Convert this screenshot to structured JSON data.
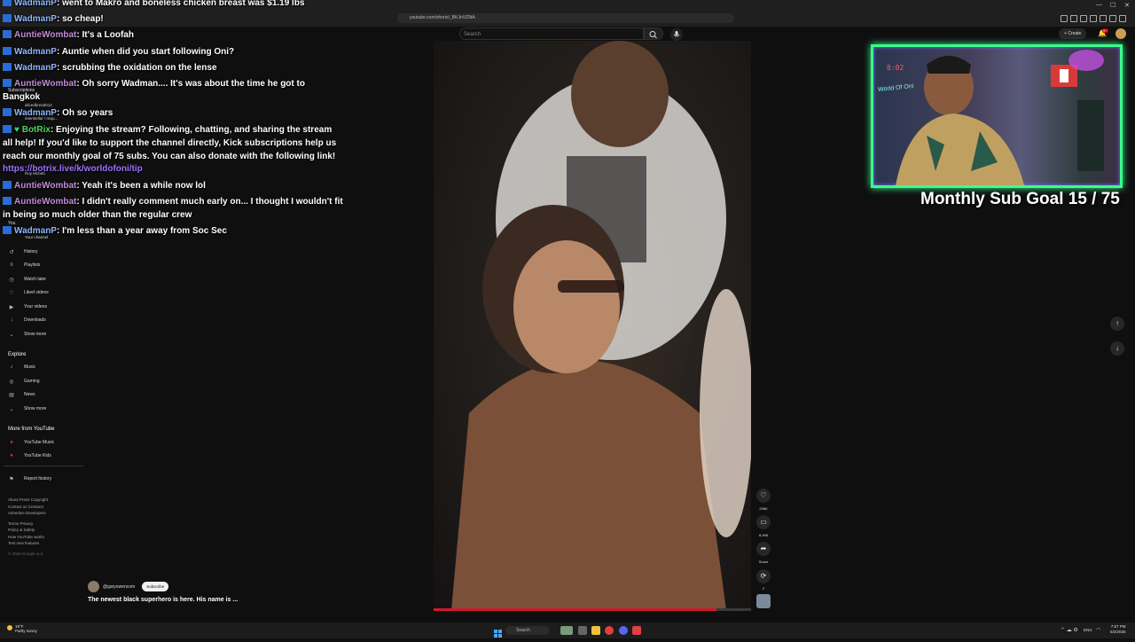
{
  "browser": {
    "url": "youtube.com/shorts/_BKJnVZ9tA",
    "window_controls": [
      "—",
      "☐",
      "✕"
    ]
  },
  "yt_header": {
    "search_placeholder": "Search",
    "create_label": "Create",
    "notification_count": "9+"
  },
  "sidebar": {
    "partial_labels": [
      "Subscriptions",
      "alicedbread012",
      "interstellar / requ...",
      "Roy Mcbeb",
      "You",
      "Your channel"
    ],
    "you_items": [
      {
        "icon": "history-icon",
        "glyph": "↺",
        "label": "History"
      },
      {
        "icon": "playlists-icon",
        "glyph": "≡",
        "label": "Playlists"
      },
      {
        "icon": "watch-later-icon",
        "glyph": "◷",
        "label": "Watch later"
      },
      {
        "icon": "liked-videos-icon",
        "glyph": "♡",
        "label": "Liked videos"
      },
      {
        "icon": "your-videos-icon",
        "glyph": "▶",
        "label": "Your videos"
      },
      {
        "icon": "downloads-icon",
        "glyph": "↓",
        "label": "Downloads"
      },
      {
        "icon": "chevron-down-icon",
        "glyph": "⌄",
        "label": "Show more"
      }
    ],
    "explore_heading": "Explore",
    "explore_items": [
      {
        "icon": "music-icon",
        "glyph": "♪",
        "label": "Music"
      },
      {
        "icon": "gaming-icon",
        "glyph": "◎",
        "label": "Gaming"
      },
      {
        "icon": "news-icon",
        "glyph": "▤",
        "label": "News"
      },
      {
        "icon": "chevron-down-icon",
        "glyph": "⌄",
        "label": "Show more"
      }
    ],
    "more_heading": "More from YouTube",
    "more_items": [
      {
        "icon": "youtube-music-icon",
        "glyph": "●",
        "label": "YouTube Music"
      },
      {
        "icon": "youtube-kids-icon",
        "glyph": "●",
        "label": "YouTube Kids"
      }
    ],
    "report_history": "Report history",
    "footer_lines": [
      "About  Press  Copyright",
      "Contact us  Creators",
      "Advertise  Developers",
      "",
      "Terms  Privacy",
      "Policy & Safety",
      "How YouTube works",
      "Test new features",
      "",
      "© 2026 Google LLC"
    ]
  },
  "chat": [
    {
      "user": "WadmanP",
      "text": ": went to Makro and boneless chicken breast was $1.19 lbs",
      "color": "u1"
    },
    {
      "user": "WadmanP",
      "text": ": so cheap!",
      "color": "u1"
    },
    {
      "user": "AuntieWombat",
      "text": ": It's a Loofah",
      "color": "u2"
    },
    {
      "user": "WadmanP",
      "text": ": Auntie when did you start following Oni?",
      "color": "u1"
    },
    {
      "user": "WadmanP",
      "text": ": scrubbing the oxidation on the lense",
      "color": "u1"
    },
    {
      "user": "AuntieWombat",
      "text": ": Oh sorry Wadman.... It's was about the time he got to",
      "color": "u2"
    },
    {
      "user": "",
      "text": "Bangkok",
      "color": "u1"
    },
    {
      "user": "WadmanP",
      "text": ": Oh so years",
      "color": "u1"
    },
    {
      "user": "BotRix",
      "text": ": Enjoying the stream? Following, chatting, and sharing the stream",
      "color": "u3"
    },
    {
      "user": "",
      "text": "all help! If you'd like to support the channel directly, Kick subscriptions help us",
      "color": "u1"
    },
    {
      "user": "",
      "text": "reach our monthly goal of 75 subs. You can also donate with the following link!",
      "color": "u1"
    },
    {
      "user": "",
      "text": "https://botrix.live/k/worldofoni/tip",
      "color": "link"
    },
    {
      "user": "AuntieWombat",
      "text": ": Yeah it's been a while now lol",
      "color": "u2"
    },
    {
      "user": "AuntieWombat",
      "text": ": I didn't really comment much early on... I thought I wouldn't fit",
      "color": "u2"
    },
    {
      "user": "",
      "text": "in being so much older than the regular crew",
      "color": "u1"
    },
    {
      "user": "WadmanP",
      "text": ": I'm less than a year away from Soc Sec",
      "color": "u1"
    }
  ],
  "short": {
    "channel": "@garyowencom",
    "subscribe_label": "Subscribe",
    "title": "The newest black superhero is here. His name is ...",
    "likes": "298K",
    "comments": "8,998",
    "share_label": "Share",
    "remix_count": "2",
    "progress": 0.89
  },
  "webcam": {
    "clock": "8:02",
    "neon_sign": "World Of Oni"
  },
  "overlay": {
    "sub_goal": "Monthly Sub Goal 15 / 75"
  },
  "taskbar": {
    "weather_temp": "19°F",
    "weather_desc": "Partly sunny",
    "search_label": "Search",
    "lang": "ENG",
    "time": "7:57 PM",
    "date": "6/2/2026"
  }
}
